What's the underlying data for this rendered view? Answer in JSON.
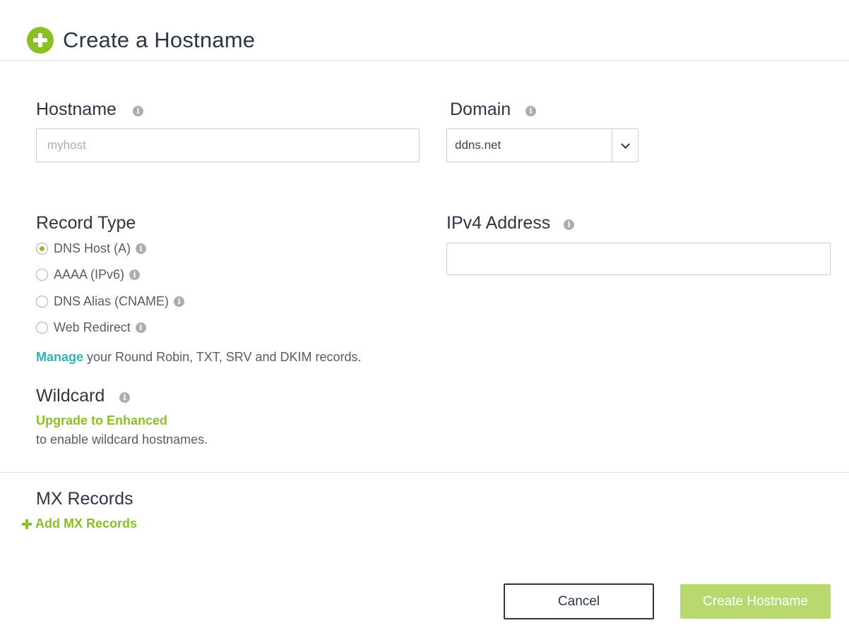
{
  "header": {
    "title": "Create a Hostname"
  },
  "hostname": {
    "label": "Hostname",
    "placeholder": "myhost",
    "value": ""
  },
  "domain": {
    "label": "Domain",
    "selected": "ddns.net"
  },
  "record_type": {
    "label": "Record Type",
    "options": [
      {
        "label": "DNS Host (A)",
        "checked": true
      },
      {
        "label": "AAAA (IPv6)",
        "checked": false
      },
      {
        "label": "DNS Alias (CNAME)",
        "checked": false
      },
      {
        "label": "Web Redirect",
        "checked": false
      }
    ],
    "manage_link": "Manage",
    "manage_text": " your Round Robin, TXT, SRV and DKIM records."
  },
  "ipv4": {
    "label": "IPv4 Address",
    "value": ""
  },
  "wildcard": {
    "label": "Wildcard",
    "upgrade_link": "Upgrade to Enhanced",
    "description": "to enable wildcard hostnames."
  },
  "mx": {
    "label": "MX Records",
    "add_label": "Add MX Records"
  },
  "actions": {
    "cancel_label": "Cancel",
    "create_label": "Create Hostname"
  },
  "colors": {
    "accent_green": "#8cbf26",
    "link_teal": "#2fb3b8",
    "create_button": "#b7d96e"
  },
  "icons": {
    "header": "plus-circle-icon",
    "info": "info-icon",
    "domain_dropdown": "chevron-down-icon",
    "add_mx": "plus-icon"
  }
}
